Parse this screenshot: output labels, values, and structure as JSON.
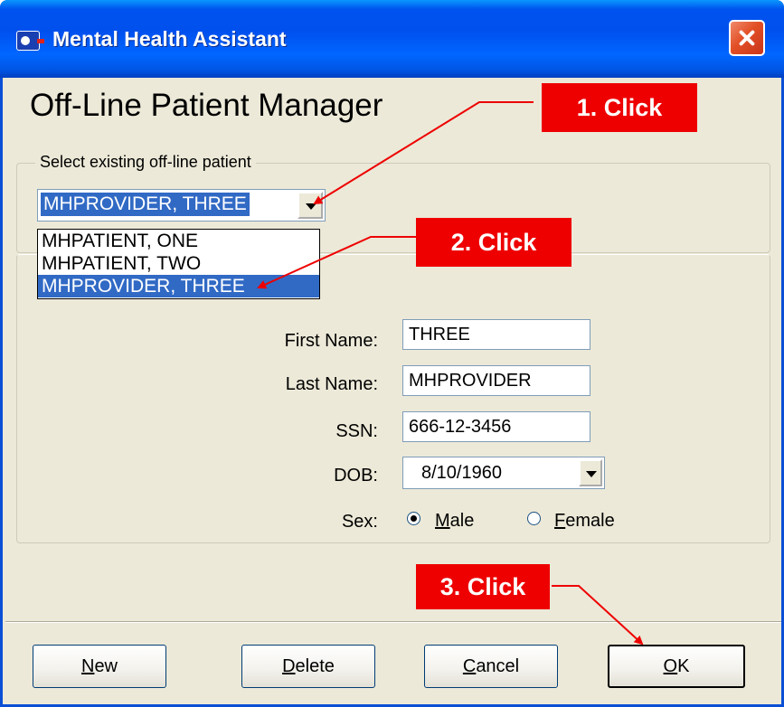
{
  "window": {
    "title": "Mental Health Assistant",
    "heading": "Off-Line Patient Manager"
  },
  "patient_select": {
    "group_label": "Select existing off-line patient",
    "selected_value": "MHPROVIDER, THREE",
    "options": [
      "MHPATIENT, ONE",
      "MHPATIENT, TWO",
      "MHPROVIDER, THREE"
    ]
  },
  "form": {
    "first_name_label": "First Name:",
    "first_name_value": "THREE",
    "last_name_label": "Last Name:",
    "last_name_value": "MHPROVIDER",
    "ssn_label": "SSN:",
    "ssn_value": "666-12-3456",
    "dob_label": "DOB:",
    "dob_value": "8/10/1960",
    "sex_label": "Sex:",
    "sex_options": [
      {
        "accel": "M",
        "rest": "ale",
        "checked": true
      },
      {
        "accel": "F",
        "rest": "emale",
        "checked": false
      }
    ]
  },
  "buttons": [
    {
      "accel": "N",
      "rest": "ew"
    },
    {
      "accel": "D",
      "rest": "elete"
    },
    {
      "accel": "C",
      "rest": "ancel"
    },
    {
      "accel": "O",
      "rest": "K"
    }
  ],
  "annotations": [
    "1. Click",
    "2. Click",
    "3. Click"
  ],
  "colors": {
    "title_bar": "#0055e5",
    "selection": "#316ac5",
    "callout": "#ee0000",
    "dialog_bg": "#ece9d8"
  }
}
